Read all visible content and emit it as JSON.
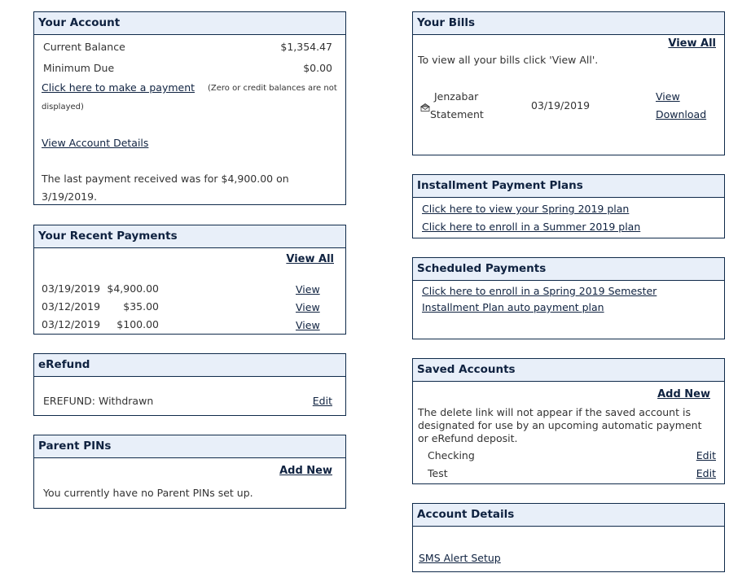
{
  "your_account": {
    "title": "Your Account",
    "current_balance_label": "Current Balance",
    "current_balance_value": "$1,354.47",
    "minimum_due_label": "Minimum Due",
    "minimum_due_value": "$0.00",
    "make_payment_link": "Click here to make a payment",
    "make_payment_note_1": "(Zero or credit balances are not",
    "make_payment_note_2": "displayed)",
    "view_details_link": "View Account Details",
    "last_payment_line1": "The last payment received was for $4,900.00 on",
    "last_payment_line2": "3/19/2019."
  },
  "recent_payments": {
    "title": "Your Recent Payments",
    "view_all": "View All",
    "rows": [
      {
        "date": "03/19/2019",
        "amount": "$4,900.00",
        "action": "View"
      },
      {
        "date": "03/12/2019",
        "amount": "$35.00",
        "action": "View"
      },
      {
        "date": "03/12/2019",
        "amount": "$100.00",
        "action": "View"
      }
    ]
  },
  "erefund": {
    "title": "eRefund",
    "status": "EREFUND: Withdrawn",
    "edit": "Edit"
  },
  "parent_pins": {
    "title": "Parent PINs",
    "add_new": "Add New",
    "message": "You currently have no Parent PINs set up."
  },
  "your_bills": {
    "title": "Your Bills",
    "view_all": "View All",
    "instructions": "To view all your bills click 'View All'.",
    "bill": {
      "icon": "envelope-icon",
      "name_line1": "Jenzabar",
      "name_line2": "Statement",
      "date": "03/19/2019",
      "view": "View",
      "download": "Download"
    }
  },
  "installment_plans": {
    "title": "Installment Payment Plans",
    "links": [
      "Click here to view your Spring 2019 plan",
      "Click here to enroll in a Summer 2019 plan"
    ]
  },
  "scheduled_payments": {
    "title": "Scheduled Payments",
    "links": [
      "Click here to enroll in a Spring 2019 Semester",
      "Installment Plan auto payment plan"
    ]
  },
  "saved_accounts": {
    "title": "Saved Accounts",
    "add_new": "Add New",
    "note_line1": "The delete link will not appear if the saved account is",
    "note_line2": "designated for use by an upcoming automatic payment",
    "note_line3": "or eRefund deposit.",
    "accounts": [
      {
        "name": "Checking",
        "action": "Edit"
      },
      {
        "name": "Test",
        "action": "Edit"
      }
    ]
  },
  "account_details": {
    "title": "Account Details",
    "sms_link": "SMS Alert Setup"
  }
}
